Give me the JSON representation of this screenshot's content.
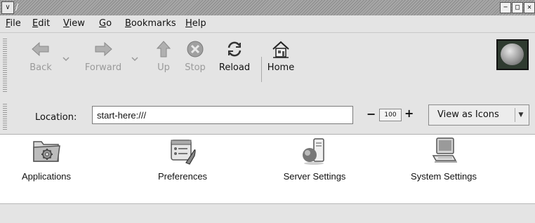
{
  "window": {
    "title": "/",
    "menu_glyph": "∨",
    "minimize": "−",
    "maximize": "□",
    "close": "✕"
  },
  "menubar": {
    "items": [
      {
        "accel": "F",
        "rest": "ile"
      },
      {
        "accel": "E",
        "rest": "dit"
      },
      {
        "accel": "V",
        "rest": "iew"
      },
      {
        "accel": "G",
        "rest": "o"
      },
      {
        "accel": "B",
        "rest": "ookmarks"
      },
      {
        "accel": "H",
        "rest": "elp"
      }
    ]
  },
  "toolbar": {
    "back": "Back",
    "forward": "Forward",
    "up": "Up",
    "stop": "Stop",
    "reload": "Reload",
    "home": "Home"
  },
  "location": {
    "label": "Location:",
    "value": "start-here:///",
    "zoom_minus": "−",
    "zoom_value": "100",
    "zoom_plus": "+",
    "view_mode": "View as Icons"
  },
  "items": [
    {
      "label": "Applications",
      "icon": "applications-folder-icon"
    },
    {
      "label": "Preferences",
      "icon": "preferences-icon"
    },
    {
      "label": "Server Settings",
      "icon": "server-settings-icon"
    },
    {
      "label": "System Settings",
      "icon": "system-settings-icon"
    }
  ]
}
